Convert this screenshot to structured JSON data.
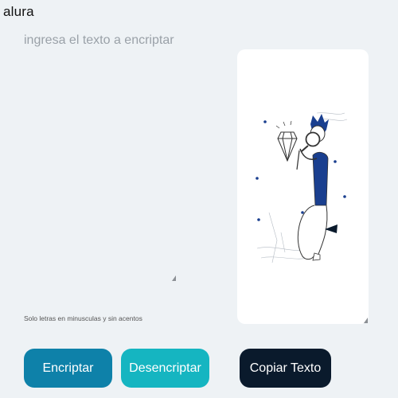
{
  "app": {
    "logo": "alura"
  },
  "input": {
    "placeholder": "ingresa el texto a encriptar",
    "value": ""
  },
  "hint": "Solo letras en minusculas y sin acentos",
  "output_panel": {
    "illustration": "person-with-magnifying-glass-diamond"
  },
  "buttons": {
    "encrypt": "Encriptar",
    "decrypt": "Desencriptar",
    "copy": "Copiar Texto"
  },
  "colors": {
    "background": "#eef2f5",
    "encrypt": "#0e81a9",
    "decrypt": "#15b5c1",
    "copy": "#0a1a2c",
    "illustration_accent": "#1a3f8f"
  }
}
